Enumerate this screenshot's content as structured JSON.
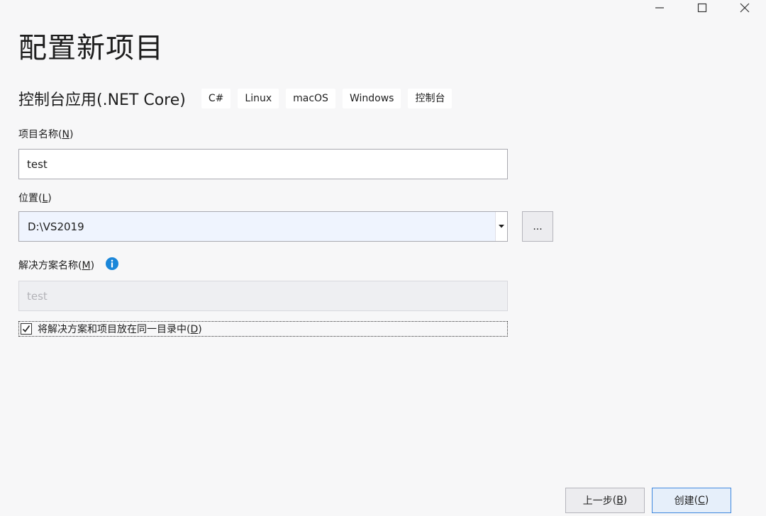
{
  "window": {
    "controls": [
      "minimize-icon",
      "maximize-icon",
      "close-icon"
    ]
  },
  "page": {
    "title": "配置新项目"
  },
  "template": {
    "name": "控制台应用(.NET Core)",
    "tags": [
      "C#",
      "Linux",
      "macOS",
      "Windows",
      "控制台"
    ]
  },
  "project_name": {
    "label": "项目名称",
    "mnemonic": "N",
    "value": "test"
  },
  "location": {
    "label": "位置",
    "mnemonic": "L",
    "value": "D:\\VS2019",
    "browse_label": "..."
  },
  "solution_name": {
    "label": "解决方案名称",
    "mnemonic": "M",
    "placeholder": "test",
    "info_icon": "info-icon"
  },
  "same_dir_checkbox": {
    "label": "将解决方案和项目放在同一目录中",
    "mnemonic": "D",
    "checked": true
  },
  "footer": {
    "back_label": "上一步",
    "back_mnemonic": "B",
    "create_label": "创建",
    "create_mnemonic": "C"
  },
  "colors": {
    "accent": "#3f88de",
    "info": "#1a86d9",
    "background": "#f7f7f8"
  }
}
